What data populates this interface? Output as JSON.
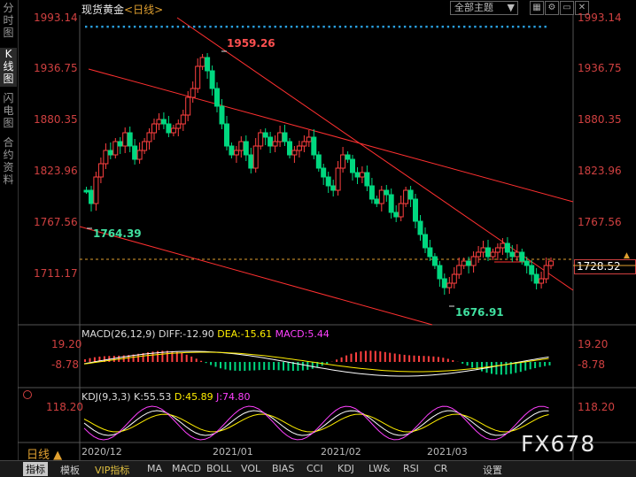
{
  "sidebar": {
    "tabs": [
      {
        "label": "分时图",
        "active": false
      },
      {
        "label": "K线图",
        "active": true
      },
      {
        "label": "闪电图",
        "active": false
      },
      {
        "label": "合约资料",
        "active": false
      }
    ]
  },
  "header": {
    "title": "现货黄金",
    "subtitle": "<日线>",
    "theme_select": "全部主题",
    "icons": [
      "grid-icon",
      "settings-icon",
      "minus-icon",
      "close-icon"
    ]
  },
  "price_axis": {
    "ticks": [
      "1993.14",
      "1936.75",
      "1880.35",
      "1823.96",
      "1767.56",
      "1711.17"
    ],
    "current_price": "1728.52"
  },
  "annotations": {
    "high": "1959.26",
    "low_left": "1764.39",
    "low_bottom": "1676.91"
  },
  "macd": {
    "label": "MACD(26,12,9)",
    "diff": "DIFF:-12.90",
    "dea": "DEA:-15.61",
    "macd": "MACD:5.44",
    "ticks": [
      "19.20",
      "-8.78"
    ]
  },
  "kdj": {
    "label": "KDJ(9,3,3)",
    "k": "K:55.53",
    "d": "D:45.89",
    "j": "J:74.80",
    "tick": "118.20"
  },
  "time_axis": {
    "labels": [
      "2020/12",
      "2021/01",
      "2021/02",
      "2021/03"
    ],
    "period": "日线 ▲"
  },
  "watermark": "FX678",
  "bottom_tabs": [
    {
      "label": "指标",
      "active": true
    },
    {
      "label": "模板",
      "active": false
    },
    {
      "label": "VIP指标",
      "active": false,
      "vip": true
    },
    {
      "label": "MA",
      "active": false
    },
    {
      "label": "MACD",
      "active": false
    },
    {
      "label": "BOLL",
      "active": false
    },
    {
      "label": "VOL",
      "active": false
    },
    {
      "label": "BIAS",
      "active": false
    },
    {
      "label": "CCI",
      "active": false
    },
    {
      "label": "KDJ",
      "active": false
    },
    {
      "label": "LW&",
      "active": false
    },
    {
      "label": "RSI",
      "active": false
    },
    {
      "label": "CR",
      "active": false
    },
    {
      "label": "设置",
      "active": false
    }
  ],
  "colors": {
    "up": "#ff4040",
    "down": "#00d880",
    "trendline": "#ff3030",
    "price_label": "#d04040",
    "k_line": "#ffffff",
    "d_line": "#ffee00",
    "j_line": "#ff40ff",
    "dots": "#2aa0e0"
  }
}
